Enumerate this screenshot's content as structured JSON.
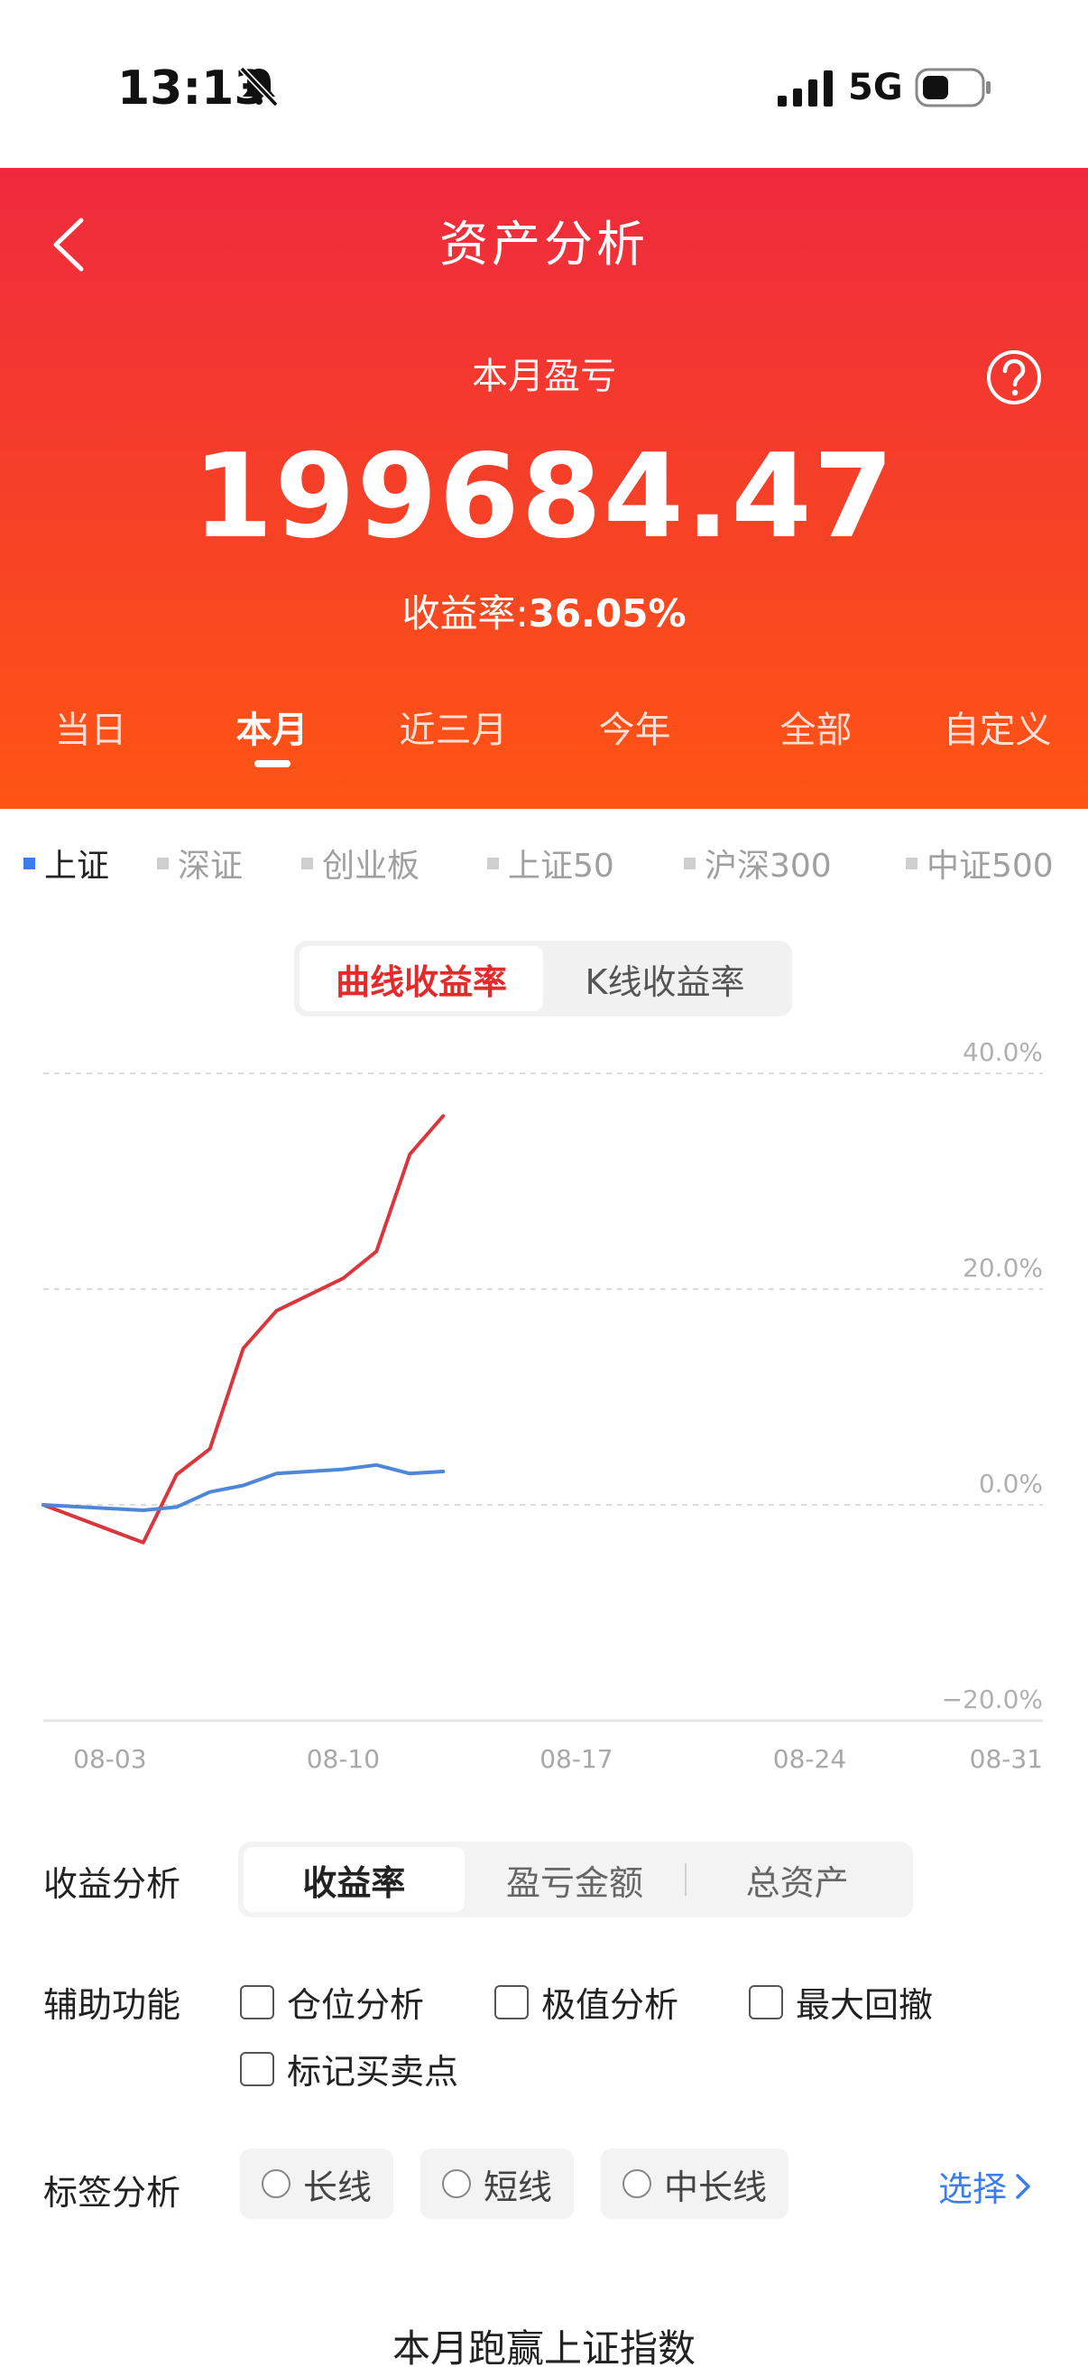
{
  "status_bar": {
    "time": "13:13",
    "network": "5G"
  },
  "header": {
    "title": "资产分析",
    "period_label": "本月盈亏",
    "profit": "199684.47",
    "rate_label": "收益率:",
    "rate_value": "36.05%"
  },
  "period_tabs": [
    {
      "label": "当日",
      "active": false
    },
    {
      "label": "本月",
      "active": true
    },
    {
      "label": "近三月",
      "active": false
    },
    {
      "label": "今年",
      "active": false
    },
    {
      "label": "全部",
      "active": false
    },
    {
      "label": "自定义",
      "active": false
    }
  ],
  "indices": [
    {
      "label": "上证",
      "active": true
    },
    {
      "label": "深证",
      "active": false
    },
    {
      "label": "创业板",
      "active": false
    },
    {
      "label": "上证50",
      "active": false
    },
    {
      "label": "沪深300",
      "active": false
    },
    {
      "label": "中证500",
      "active": false
    }
  ],
  "chart_toggle": [
    {
      "label": "曲线收益率",
      "active": true
    },
    {
      "label": "K线收益率",
      "active": false
    }
  ],
  "colors": {
    "portfolio": "#d9363e",
    "index": "#4e86d8",
    "accent": "#e42a2a",
    "link": "#3b7ded"
  },
  "chart_data": {
    "type": "line",
    "x_ticks": [
      "08-03",
      "08-10",
      "08-17",
      "08-24",
      "08-31"
    ],
    "y_ticks": [
      "40.0%",
      "20.0%",
      "0.0%",
      "−20.0%"
    ],
    "ylim": [
      -20,
      40
    ],
    "xlim_days": [
      "08-01",
      "08-31"
    ],
    "grid": true,
    "series": [
      {
        "color": "#d9363e",
        "points": [
          [
            "08-01",
            0
          ],
          [
            "08-04",
            -3.5
          ],
          [
            "08-05",
            2.8
          ],
          [
            "08-06",
            5.2
          ],
          [
            "08-07",
            14.5
          ],
          [
            "08-08",
            18
          ],
          [
            "08-10",
            21
          ],
          [
            "08-11",
            23.5
          ],
          [
            "08-12",
            32.5
          ],
          [
            "08-13",
            36.05
          ]
        ]
      },
      {
        "color": "#4e86d8",
        "points": [
          [
            "08-01",
            0
          ],
          [
            "08-04",
            -0.5
          ],
          [
            "08-05",
            -0.2
          ],
          [
            "08-06",
            1.2
          ],
          [
            "08-07",
            1.8
          ],
          [
            "08-08",
            2.9
          ],
          [
            "08-10",
            3.3
          ],
          [
            "08-11",
            3.7
          ],
          [
            "08-12",
            2.9
          ],
          [
            "08-13",
            3.1
          ]
        ]
      }
    ]
  },
  "profit_analysis": {
    "label": "收益分析",
    "options": [
      {
        "label": "收益率",
        "active": true
      },
      {
        "label": "盈亏金额",
        "active": false
      },
      {
        "label": "总资产",
        "active": false
      }
    ]
  },
  "aux": {
    "label": "辅助功能",
    "items": [
      {
        "label": "仓位分析",
        "checked": false
      },
      {
        "label": "极值分析",
        "checked": false
      },
      {
        "label": "最大回撤",
        "checked": false
      },
      {
        "label": "标记买卖点",
        "checked": false
      }
    ]
  },
  "tags": {
    "label": "标签分析",
    "items": [
      "长线",
      "短线",
      "中长线"
    ],
    "select_label": "选择"
  },
  "beat": {
    "title": "本月跑赢上证指数"
  }
}
